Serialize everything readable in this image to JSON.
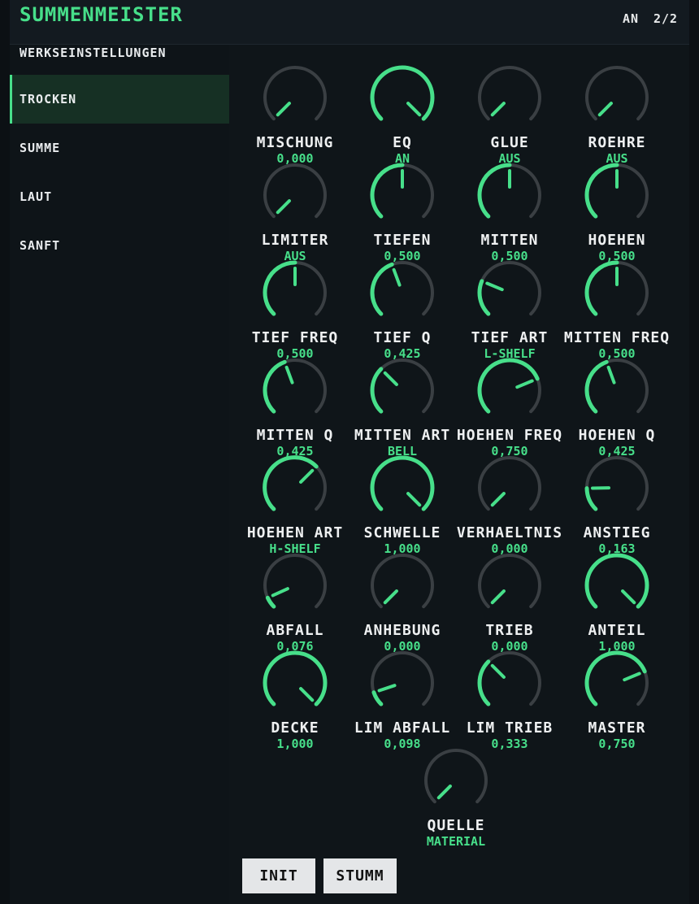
{
  "header": {
    "title": "SUMMENMEISTER",
    "status": "AN",
    "page": "2/2"
  },
  "sidebar": {
    "items": [
      {
        "label": "WERKSEINSTELLUNGEN",
        "selected": false
      },
      {
        "label": "TROCKEN",
        "selected": true
      },
      {
        "label": "SUMME",
        "selected": false
      },
      {
        "label": "LAUT",
        "selected": false
      },
      {
        "label": "SANFT",
        "selected": false
      }
    ]
  },
  "knobs": [
    {
      "label": "MISCHUNG",
      "value": "0,000",
      "level": 0.0
    },
    {
      "label": "EQ",
      "value": "AN",
      "level": 1.0
    },
    {
      "label": "GLUE",
      "value": "AUS",
      "level": 0.0
    },
    {
      "label": "ROEHRE",
      "value": "AUS",
      "level": 0.0
    },
    {
      "label": "LIMITER",
      "value": "AUS",
      "level": 0.0
    },
    {
      "label": "TIEFEN",
      "value": "0,500",
      "level": 0.5
    },
    {
      "label": "MITTEN",
      "value": "0,500",
      "level": 0.5
    },
    {
      "label": "HOEHEN",
      "value": "0,500",
      "level": 0.5
    },
    {
      "label": "TIEF FREQ",
      "value": "0,500",
      "level": 0.5
    },
    {
      "label": "TIEF Q",
      "value": "0,425",
      "level": 0.425
    },
    {
      "label": "TIEF ART",
      "value": "L-SHELF",
      "level": 0.25
    },
    {
      "label": "MITTEN FREQ",
      "value": "0,500",
      "level": 0.5
    },
    {
      "label": "MITTEN Q",
      "value": "0,425",
      "level": 0.425
    },
    {
      "label": "MITTEN ART",
      "value": "BELL",
      "level": 0.333
    },
    {
      "label": "HOEHEN FREQ",
      "value": "0,750",
      "level": 0.75
    },
    {
      "label": "HOEHEN Q",
      "value": "0,425",
      "level": 0.425
    },
    {
      "label": "HOEHEN ART",
      "value": "H-SHELF",
      "level": 0.667
    },
    {
      "label": "SCHWELLE",
      "value": "1,000",
      "level": 1.0
    },
    {
      "label": "VERHAELTNIS",
      "value": "0,000",
      "level": 0.0
    },
    {
      "label": "ANSTIEG",
      "value": "0,163",
      "level": 0.163
    },
    {
      "label": "ABFALL",
      "value": "0,076",
      "level": 0.076
    },
    {
      "label": "ANHEBUNG",
      "value": "0,000",
      "level": 0.0
    },
    {
      "label": "TRIEB",
      "value": "0,000",
      "level": 0.0
    },
    {
      "label": "ANTEIL",
      "value": "1,000",
      "level": 1.0
    },
    {
      "label": "DECKE",
      "value": "1,000",
      "level": 1.0
    },
    {
      "label": "LIM ABFALL",
      "value": "0,098",
      "level": 0.098
    },
    {
      "label": "LIM TRIEB",
      "value": "0,333",
      "level": 0.333
    },
    {
      "label": "MASTER",
      "value": "0,750",
      "level": 0.75
    },
    {
      "label": "QUELLE",
      "value": "MATERIAL",
      "level": 0.0
    }
  ],
  "buttons": {
    "init": "INIT",
    "stumm": "STUMM"
  },
  "colors": {
    "accent": "#47df8a",
    "track": "#3a3f43",
    "text": "#eef0f1",
    "background": "#0c1014"
  }
}
